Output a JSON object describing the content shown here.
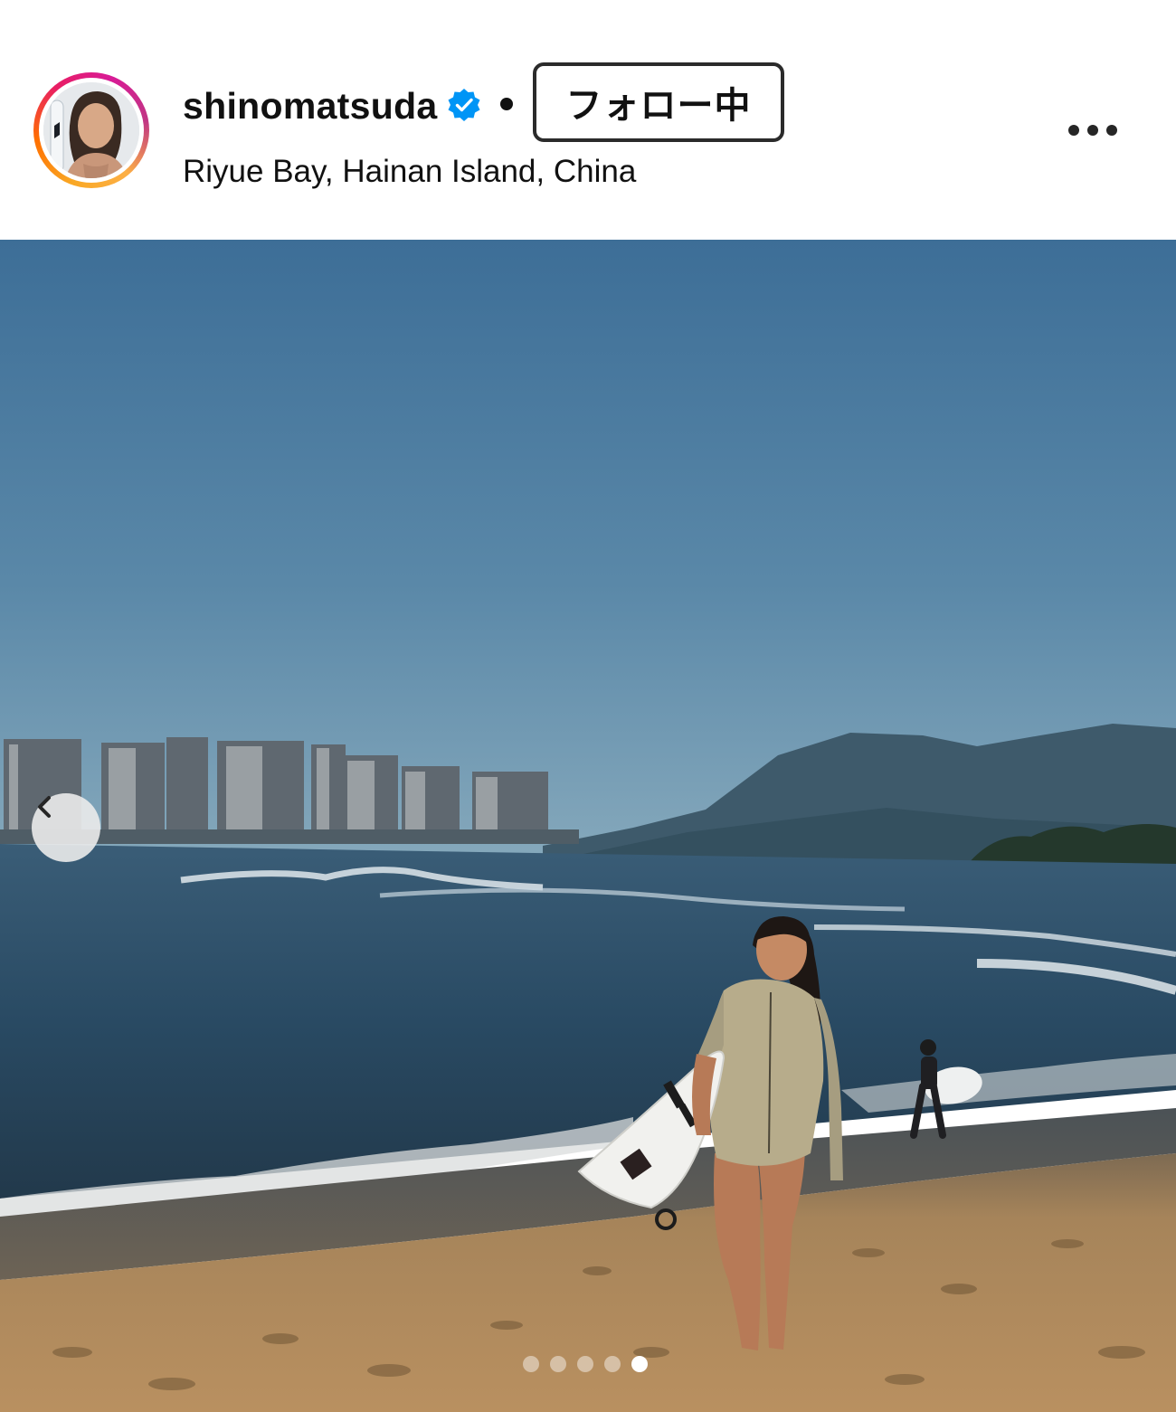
{
  "post_header": {
    "username": "shinomatsuda",
    "verified_icon": "verified-badge-icon",
    "separator": "•",
    "follow_button_label": "フォロー中",
    "location": "Riyue Bay, Hainan Island, China",
    "more_icon": "more-options-icon"
  },
  "carousel": {
    "prev_icon": "chevron-left-icon",
    "slide_count": 5,
    "active_index": 4
  },
  "colors": {
    "verified_blue": "#0095f6",
    "sky_top": "#3f6f96",
    "sky_bottom": "#7fa3ba",
    "sea": "#2b4b64",
    "sand": "#b58a55"
  }
}
